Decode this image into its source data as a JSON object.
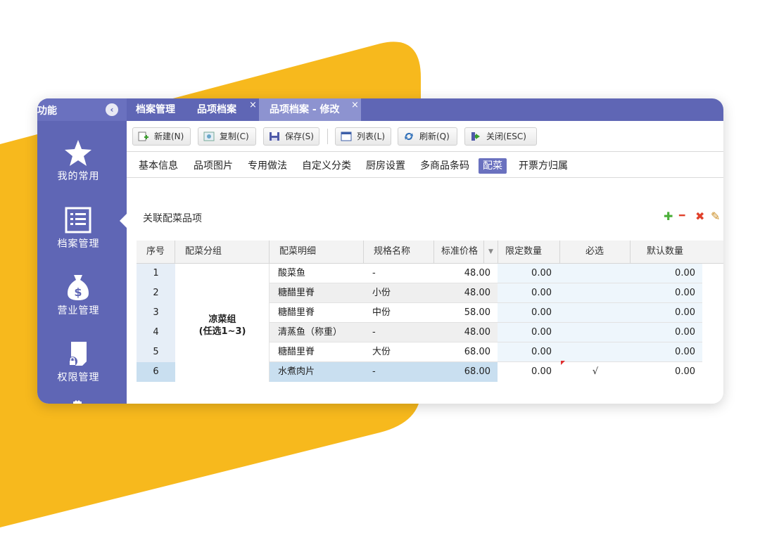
{
  "sidebar": {
    "title": "功能",
    "collapse_icon": "chevron-left-icon",
    "items": [
      {
        "label": "我的常用",
        "icon": "star-icon"
      },
      {
        "label": "档案管理",
        "icon": "list-document-icon"
      },
      {
        "label": "营业管理",
        "icon": "money-bag-icon"
      },
      {
        "label": "权限管理",
        "icon": "lock-document-icon"
      }
    ]
  },
  "tabs": [
    {
      "label": "档案管理",
      "closable": false
    },
    {
      "label": "品项档案",
      "closable": true
    },
    {
      "label": "品项档案 - 修改",
      "closable": true,
      "active": true
    }
  ],
  "tab_close_glyph": "×",
  "toolbar": {
    "new_label": "新建(N)",
    "copy_label": "复制(C)",
    "save_label": "保存(S)",
    "list_label": "列表(L)",
    "refresh_label": "刷新(Q)",
    "close_label": "关闭(ESC)"
  },
  "subtabs": [
    "基本信息",
    "品项图片",
    "专用做法",
    "自定义分类",
    "厨房设置",
    "多商品条码",
    "配菜",
    "开票方归属"
  ],
  "subtab_active": "配菜",
  "section": {
    "title": "关联配菜品项",
    "actions": {
      "add": "✚",
      "remove": "━",
      "delete": "✖",
      "edit": "✎"
    }
  },
  "grid": {
    "columns": [
      "序号",
      "配菜分组",
      "配菜明细",
      "规格名称",
      "标准价格",
      "限定数量",
      "必选",
      "默认数量"
    ],
    "sort_glyph": "▼",
    "group": {
      "line1": "凉菜组",
      "line2": "(任选1~3)"
    },
    "rows": [
      {
        "seq": "1",
        "detail": "酸菜鱼",
        "spec": "-",
        "price": "48.00",
        "limit": "0.00",
        "required": "",
        "default": "0.00"
      },
      {
        "seq": "2",
        "detail": "糖醋里脊",
        "spec": "小份",
        "price": "48.00",
        "limit": "0.00",
        "required": "",
        "default": "0.00"
      },
      {
        "seq": "3",
        "detail": "糖醋里脊",
        "spec": "中份",
        "price": "58.00",
        "limit": "0.00",
        "required": "",
        "default": "0.00"
      },
      {
        "seq": "4",
        "detail": "清蒸鱼（称重）",
        "spec": "-",
        "price": "48.00",
        "limit": "0.00",
        "required": "",
        "default": "0.00"
      },
      {
        "seq": "5",
        "detail": "糖醋里脊",
        "spec": "大份",
        "price": "68.00",
        "limit": "0.00",
        "required": "",
        "default": "0.00"
      },
      {
        "seq": "6",
        "detail": "水煮肉片",
        "spec": "-",
        "price": "68.00",
        "limit": "0.00",
        "required": "√",
        "default": "0.00"
      }
    ]
  },
  "colors": {
    "accent": "#5f66b5",
    "background_shape": "#f7b91d",
    "selected_row": "#c9dff0"
  }
}
